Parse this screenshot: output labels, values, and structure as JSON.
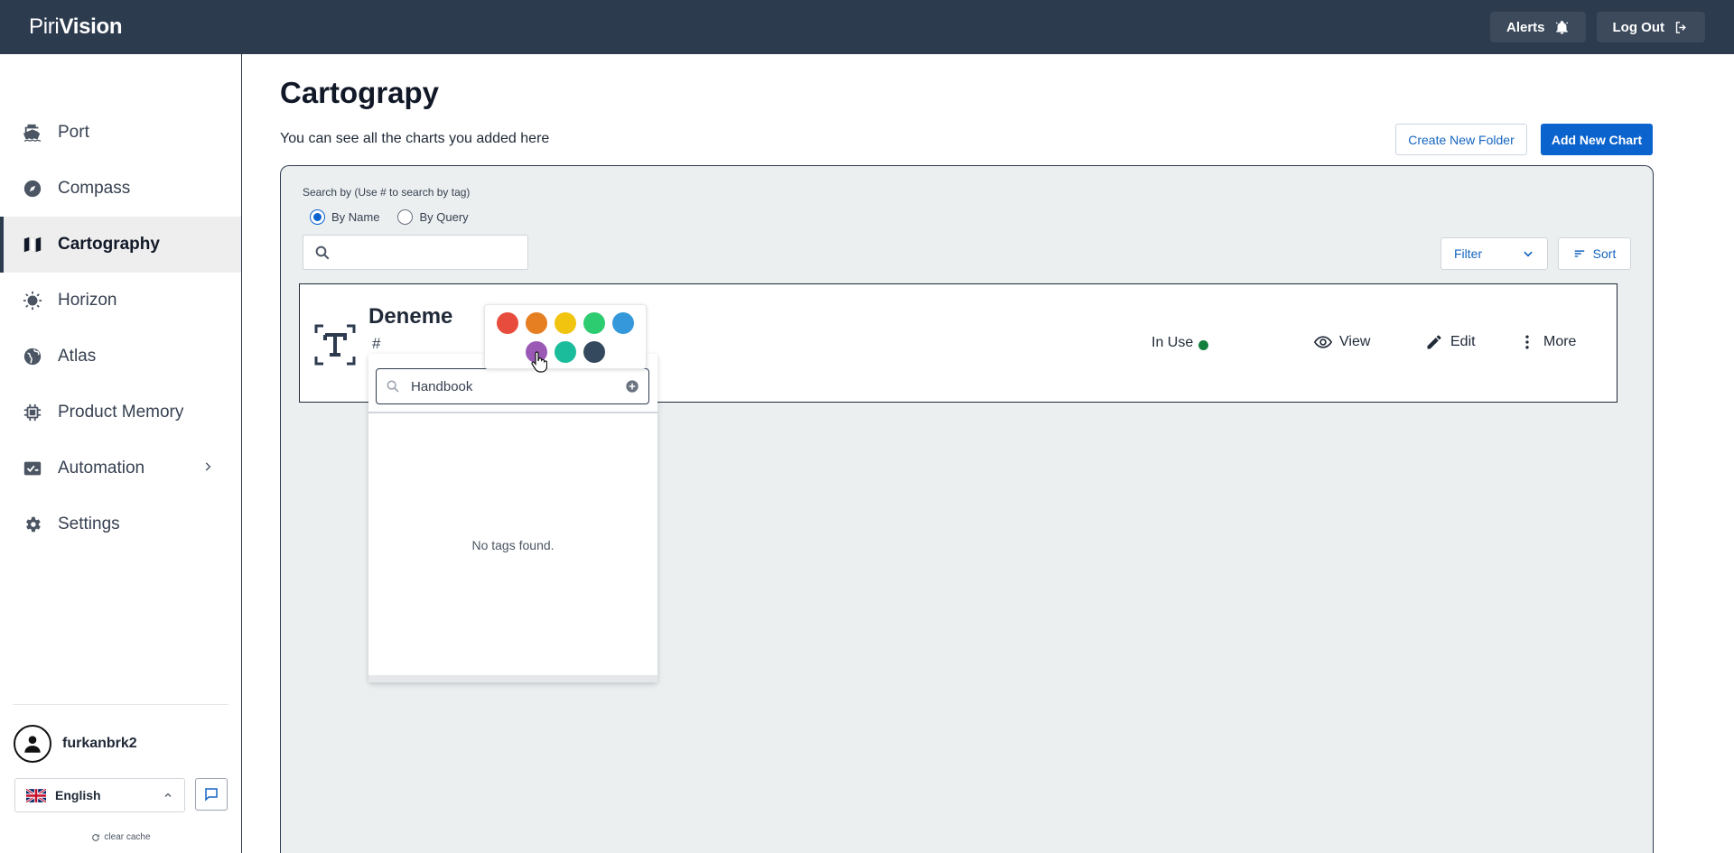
{
  "header": {
    "logo_part1": "Piri",
    "logo_part2": "Vision",
    "alerts_label": "Alerts",
    "logout_label": "Log Out"
  },
  "sidebar": {
    "items": [
      {
        "label": "Port",
        "icon": "ship-icon"
      },
      {
        "label": "Compass",
        "icon": "compass-icon"
      },
      {
        "label": "Cartography",
        "icon": "map-icon",
        "active": true
      },
      {
        "label": "Horizon",
        "icon": "sun-icon"
      },
      {
        "label": "Atlas",
        "icon": "globe-icon"
      },
      {
        "label": "Product Memory",
        "icon": "chip-icon"
      },
      {
        "label": "Automation",
        "icon": "automation-icon",
        "has_submenu": true
      },
      {
        "label": "Settings",
        "icon": "gear-icon"
      }
    ],
    "user": {
      "name": "furkanbrk2"
    },
    "language": {
      "selected": "English",
      "flag": "uk-flag-icon"
    },
    "clear_cache": "clear cache"
  },
  "main": {
    "title": "Cartograpy",
    "subtitle": "You can see all the charts you added here",
    "create_folder_label": "Create New Folder",
    "add_chart_label": "Add New Chart",
    "search_by_label": "Search by  (Use # to search by tag)",
    "radio_by_name": "By Name",
    "radio_by_query": "By Query",
    "search_placeholder": "",
    "filter_label": "Filter",
    "sort_label": "Sort"
  },
  "chart_card": {
    "title": "Deneme",
    "tag_prefix": "#",
    "status": "In Use",
    "status_color": "#15803d",
    "view_label": "View",
    "edit_label": "Edit",
    "more_label": "More"
  },
  "tag_popover": {
    "search_value": "Handbook",
    "empty_message": "No tags found."
  },
  "palette": {
    "colors": [
      "#e74c3c",
      "#e67e22",
      "#f1c40f",
      "#2ecc71",
      "#3498db",
      "#9b59b6",
      "#1abc9c",
      "#34495e"
    ],
    "hovered": "#9b59b6"
  },
  "colors": {
    "header_bg": "#2d3b4e",
    "accent": "#0b63ce",
    "panel_bg": "#ebeff0"
  }
}
